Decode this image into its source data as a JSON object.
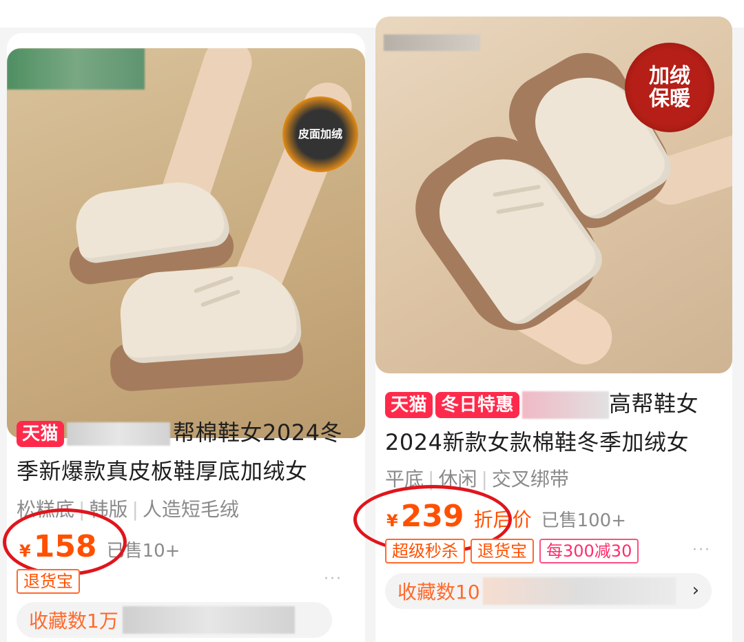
{
  "products": [
    {
      "image_badge": "皮面加绒",
      "tag_platform": "天猫",
      "title_visible": "帮棉鞋女2024冬",
      "title_line2": "季新爆款真皮板鞋厚底加绒女",
      "attributes": [
        "松糕底",
        "韩版",
        "人造短毛绒"
      ],
      "currency": "¥",
      "price": "158",
      "sold": "已售10+",
      "promos": [
        "退货宝"
      ],
      "more": "···",
      "favorites": "收藏数1万"
    },
    {
      "image_badge_line1": "加绒",
      "image_badge_line2": "保暖",
      "tag_platform": "天猫",
      "tag_promo": "冬日特惠",
      "title_visible": "高帮鞋女",
      "title_line2": "2024新款女款棉鞋冬季加绒女",
      "attributes": [
        "平底",
        "休闲",
        "交叉绑带"
      ],
      "currency": "¥",
      "price": "239",
      "price_note": "折后价",
      "sold": "已售100+",
      "promos": [
        "超级秒杀",
        "退货宝",
        "每300减30"
      ],
      "more": "···",
      "favorites": "收藏数10",
      "chevron": "›"
    }
  ],
  "colors": {
    "price": "#ff5000",
    "tag_red": "#ff2a4b",
    "annotation_circle": "#e0151c"
  }
}
